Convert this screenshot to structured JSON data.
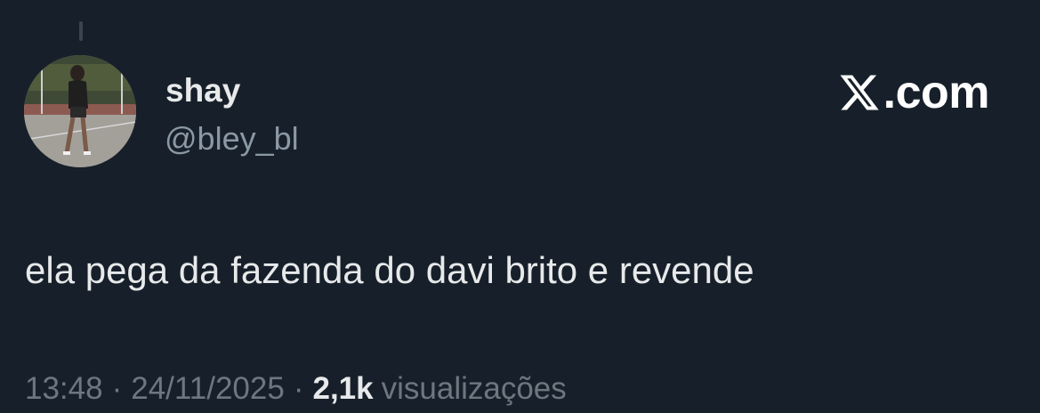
{
  "author": {
    "display_name": "shay",
    "handle": "@bley_bl"
  },
  "brand": {
    "logo": "x-logo-icon",
    "text": ".com"
  },
  "tweet": {
    "text": "ela pega da fazenda do davi brito e revende"
  },
  "meta": {
    "time": "13:48",
    "separator": "·",
    "date": "24/11/2025",
    "views_count": "2,1k",
    "views_label": "visualizações"
  },
  "colors": {
    "background": "#17202a",
    "primary_text": "#e7e9ea",
    "secondary_text": "#8b98a5",
    "meta_text": "#6e7780"
  }
}
